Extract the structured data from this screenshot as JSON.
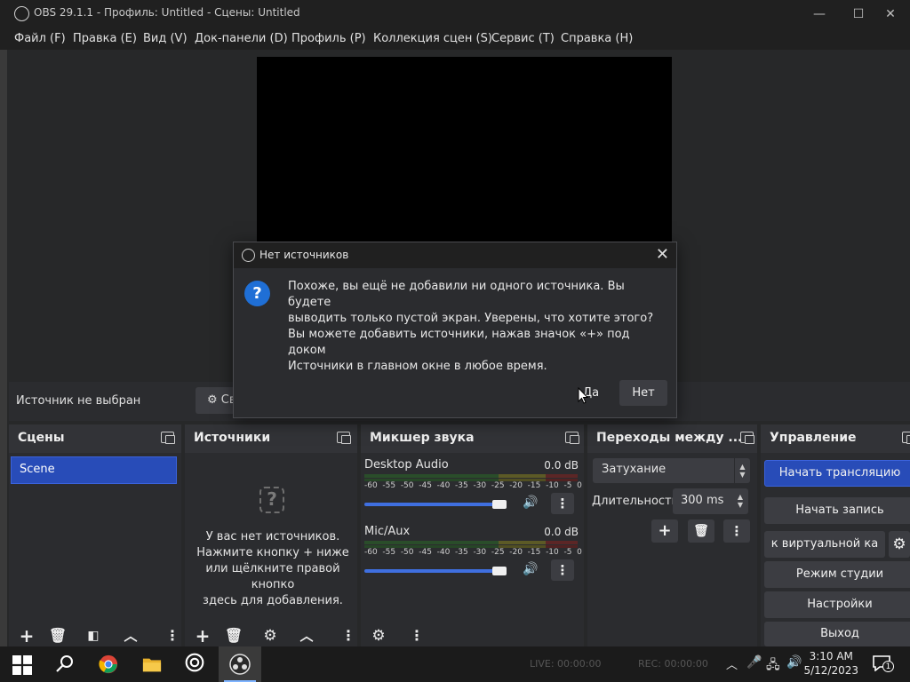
{
  "window": {
    "title": "OBS 29.1.1 - Профиль: Untitled - Сцены: Untitled",
    "minimize_glyph": "—",
    "maximize_glyph": "☐",
    "close_glyph": "✕"
  },
  "menu": [
    "Файл (F)",
    "Правка (E)",
    "Вид (V)",
    "Док-панели (D)",
    "Профиль (P)",
    "Коллекция сцен (S)",
    "Сервис (T)",
    "Справка (H)"
  ],
  "source_bar": {
    "label": "Источник не выбран",
    "properties_label": "Св"
  },
  "docks": {
    "scenes": {
      "title": "Сцены",
      "items": [
        "Scene"
      ]
    },
    "sources": {
      "title": "Источники",
      "empty_lines": [
        "У вас нет источников.",
        "Нажмите кнопку + ниже",
        "или щёлкните правой кнопко",
        "здесь для добавления."
      ]
    },
    "mixer": {
      "title": "Микшер звука",
      "ticks": [
        "-60",
        "-55",
        "-50",
        "-45",
        "-40",
        "-35",
        "-30",
        "-25",
        "-20",
        "-15",
        "-10",
        "-5",
        "0"
      ],
      "channels": [
        {
          "name": "Desktop Audio",
          "db": "0.0 dB",
          "volume": 1.0
        },
        {
          "name": "Mic/Aux",
          "db": "0.0 dB",
          "volume": 1.0
        }
      ]
    },
    "transitions": {
      "title": "Переходы между ...",
      "selected": "Затухание",
      "duration_label": "Длительность",
      "duration_value": "300 ms"
    },
    "controls": {
      "title": "Управление",
      "buttons": [
        "Начать трансляцию",
        "Начать запись",
        "к виртуальной ка",
        "Режим студии",
        "Настройки",
        "Выход"
      ]
    }
  },
  "dialog": {
    "title": "Нет источников",
    "line1": "Похоже, вы ещё не добавили ни одного источника. Вы будете",
    "line2": "выводить только пустой экран. Уверены, что хотите этого?",
    "line3": "Вы можете добавить источники, нажав значок «+» под доком",
    "line4": "Источники в главном окне в любое время.",
    "yes": "Да",
    "no": "Нет"
  },
  "taskbar": {
    "live": "LIVE: 00:00:00",
    "rec": "REC: 00:00:00",
    "time": "3:10 AM",
    "date": "5/12/2023",
    "notifications": "1"
  },
  "colors": {
    "accent": "#284cb8",
    "dialog_icon": "#1f6fd6",
    "panel": "#2b2c2f",
    "panel_header": "#323337"
  }
}
